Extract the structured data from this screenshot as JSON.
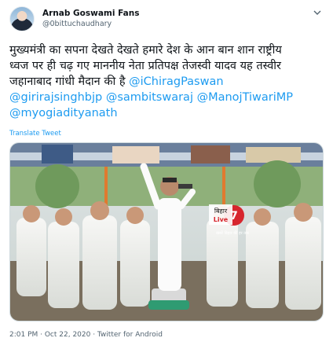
{
  "user": {
    "display_name": "Arnab Goswami Fans",
    "handle": "@0bittuchaudhary"
  },
  "tweet": {
    "line1": "मुख्यमंत्री का सपना देखते देखते हमारे देश के आन बान शान राष्ट्रीय",
    "line2": "ध्वज पर ही चढ़ गए माननीय नेता प्रतिपक्ष तेजस्वी यादव यह तस्वीर",
    "line3_text": "जहानाबाद गांधी मैदान की है ",
    "mentions": {
      "chirag": "@iChiragPaswan",
      "giriraj": "@girirajsinghbjp",
      "sambit": "@sambitswaraj",
      "manoj": "@ManojTiwariMP",
      "yogi": "@myogiadityanath"
    },
    "translate_label": "Translate Tweet"
  },
  "media": {
    "watermark_line1": "बिहार",
    "watermark_line2": "Live",
    "watermark_caption": "खबरें बिहार की हर तक"
  },
  "footer": {
    "timestamp": "2:01 PM · Oct 22, 2020 · Twitter for Android"
  }
}
